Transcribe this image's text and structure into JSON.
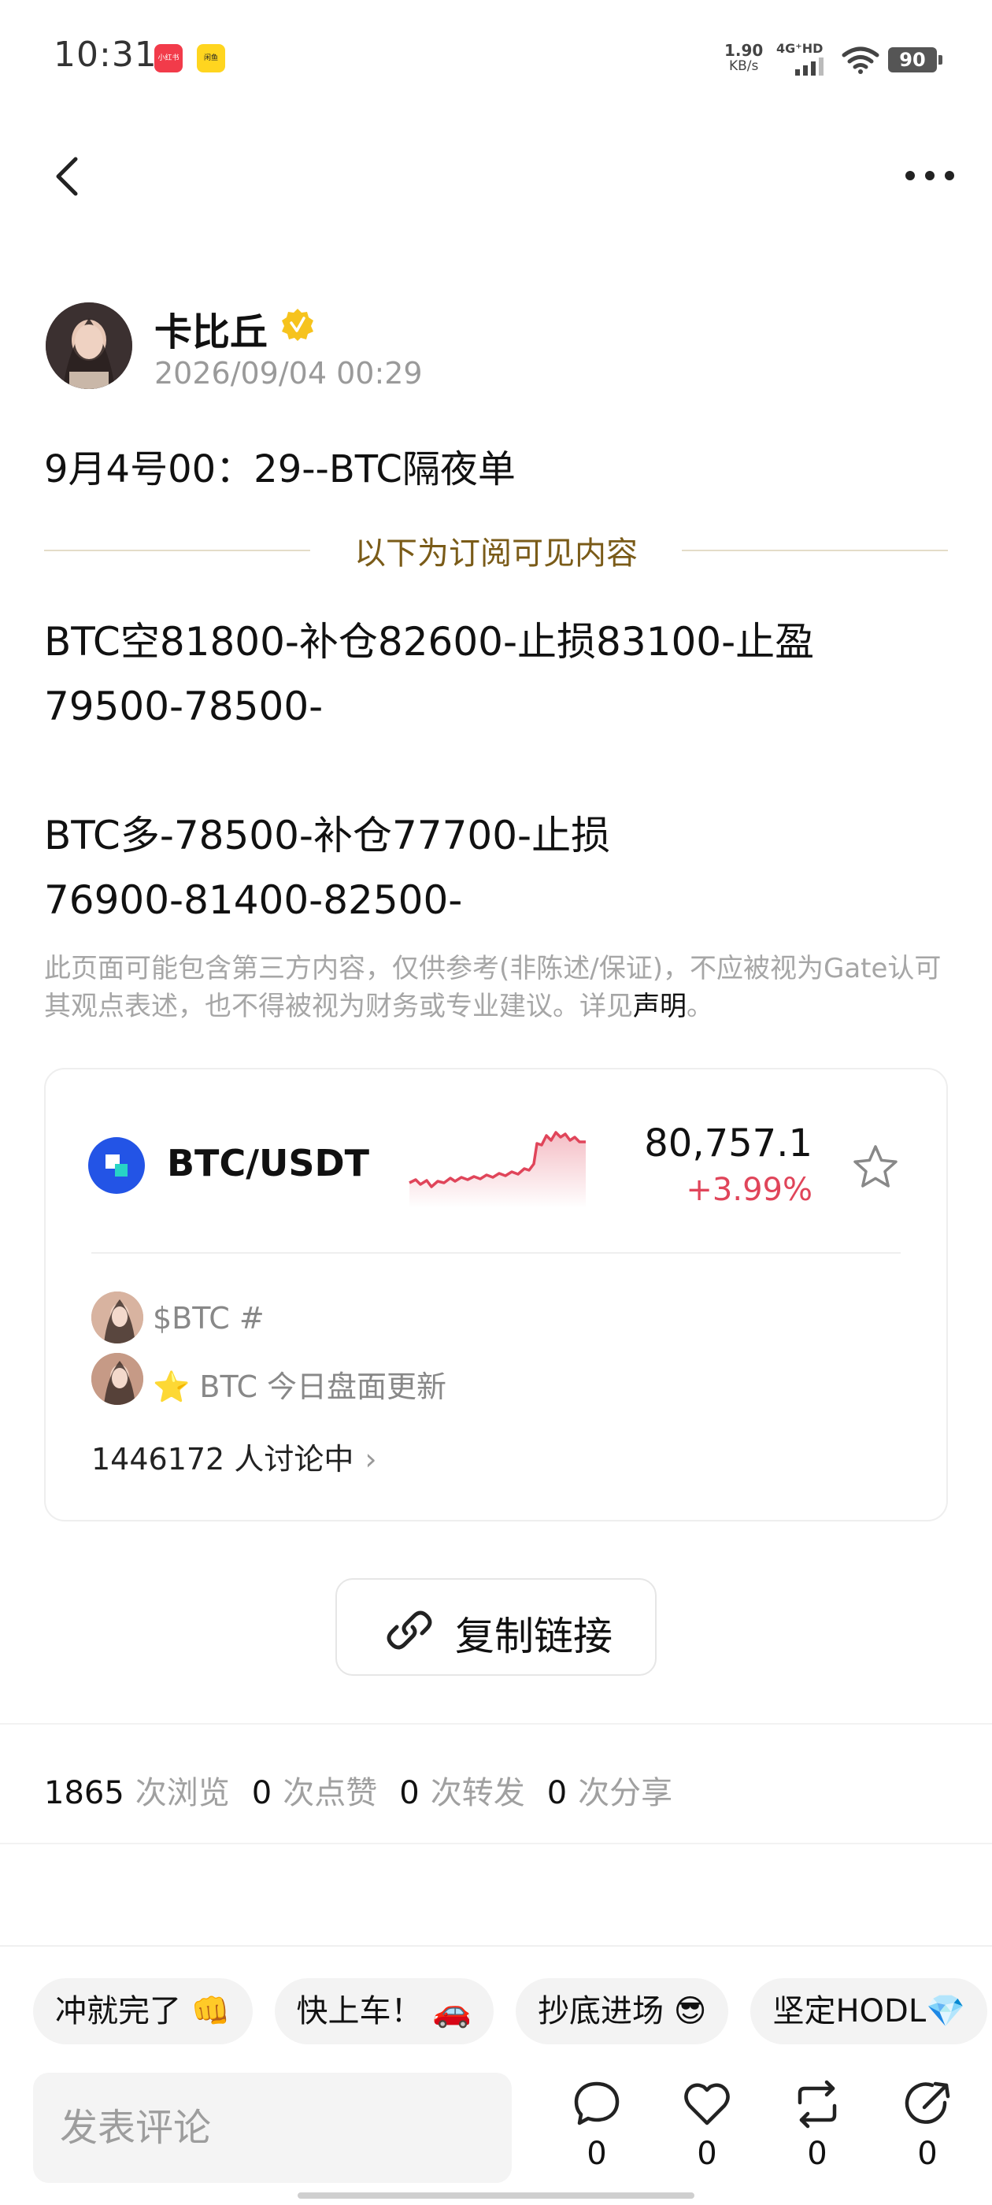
{
  "status_bar": {
    "time": "10:31",
    "app_icon_1": "小红书",
    "app_icon_2": "闲鱼",
    "net_speed_value": "1.90",
    "net_speed_unit": "KB/s",
    "signal_label": "4G⁺HD",
    "battery": "90",
    "icons": [
      "signal-icon",
      "wifi-icon",
      "battery-icon"
    ]
  },
  "nav": {
    "back_icon": "chevron-left-icon",
    "more_icon": "more-horizontal-icon"
  },
  "author": {
    "name": "卡比丘",
    "verified_icon": "verified-badge-icon",
    "date": "2026/09/04 00:29"
  },
  "post": {
    "title": "9月4号00：29--BTC隔夜单",
    "subscriber_divider": "以下为订阅可见内容",
    "body_1_line_1": "BTC空81800-补仓82600-止损83100-止盈",
    "body_1_line_2": "79500-78500-",
    "body_2_line_1": "BTC多-78500-补仓77700-止损",
    "body_2_line_2": "76900-81400-82500-",
    "disclaimer_text": "此页面可能包含第三方内容，仅供参考(非陈述/保证)，不应被视为Gate认可其观点表述，也不得被视为财务或专业建议。详见",
    "disclaimer_link": "声明",
    "disclaimer_end": "。"
  },
  "market_card": {
    "pair": "BTC/USDT",
    "price": "80,757.1",
    "change": "+3.99%",
    "colors": {
      "down_red": "#e0455a",
      "coin_blue": "#2354e6"
    },
    "topics": [
      {
        "text": "$BTC #"
      },
      {
        "text": "⭐ BTC 今日盘面更新"
      }
    ],
    "discussion": "1446172 人讨论中",
    "discussion_chevron": "›"
  },
  "copy_link": {
    "label": "复制链接",
    "icon": "link-icon"
  },
  "stats": [
    {
      "num": "1865",
      "label": "次浏览"
    },
    {
      "num": "0",
      "label": "次点赞"
    },
    {
      "num": "0",
      "label": "次转发"
    },
    {
      "num": "0",
      "label": "次分享"
    }
  ],
  "quick_replies": [
    "冲就完了 👊",
    "快上车！ 🚗",
    "抄底进场 😎",
    "坚定HODL💎"
  ],
  "comment": {
    "placeholder": "发表评论"
  },
  "actions": [
    {
      "name": "comment",
      "count": "0"
    },
    {
      "name": "like",
      "count": "0"
    },
    {
      "name": "repost",
      "count": "0"
    },
    {
      "name": "share",
      "count": "0"
    }
  ]
}
